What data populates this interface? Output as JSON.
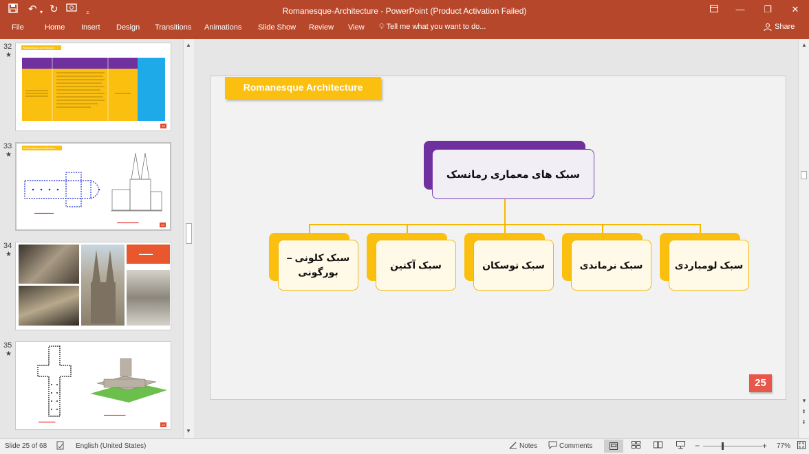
{
  "window": {
    "title": "Romanesque-Architecture - PowerPoint (Product Activation Failed)",
    "accent_color": "#b7472a"
  },
  "quick_access": [
    "save-icon",
    "undo-icon",
    "redo-icon",
    "present-icon",
    "customize-icon"
  ],
  "ribbon": {
    "tabs": [
      "File",
      "Home",
      "Insert",
      "Design",
      "Transitions",
      "Animations",
      "Slide Show",
      "Review",
      "View"
    ],
    "tell_me": "Tell me what you want to do...",
    "share": "Share"
  },
  "thumbnails": [
    {
      "number": "32",
      "star": "★",
      "tag": "Romanesque Architecture",
      "page": "32"
    },
    {
      "number": "33",
      "star": "★",
      "tag": "Romanesque Architecture",
      "page": "23"
    },
    {
      "number": "34",
      "star": "★",
      "page": ""
    },
    {
      "number": "35",
      "star": "★",
      "page": "23"
    }
  ],
  "slide": {
    "tag": "Romanesque Architecture",
    "root": "سبک های معماری رمانسک",
    "children": [
      "سبک کلونی – بورگونی",
      "سبک آکتین",
      "سبک توسکان",
      "سبک نرماندی",
      "سبک لومباردی"
    ],
    "number": "25",
    "colors": {
      "purple": "#7030a0",
      "yellow": "#fbbf10",
      "red": "#e8574a"
    }
  },
  "status": {
    "slide_info": "Slide 25 of 68",
    "language": "English (United States)",
    "notes": "Notes",
    "comments": "Comments",
    "zoom": "77%"
  }
}
